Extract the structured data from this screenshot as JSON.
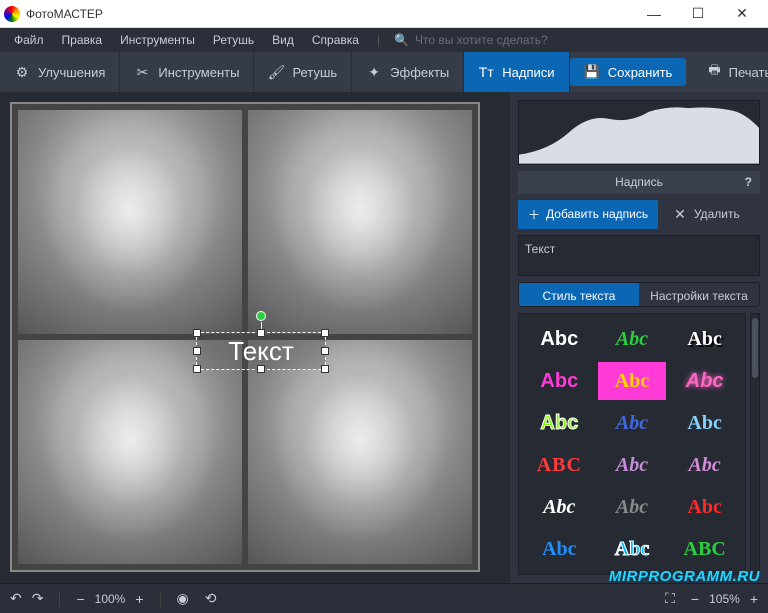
{
  "app": {
    "title": "ФотоМАСТЕР"
  },
  "menu": {
    "file": "Файл",
    "edit": "Правка",
    "tools": "Инструменты",
    "retouch": "Ретушь",
    "view": "Вид",
    "help": "Справка",
    "search_placeholder": "Что вы хотите сделать?"
  },
  "tabs": {
    "enhance": "Улучшения",
    "tools": "Инструменты",
    "retouch": "Ретушь",
    "effects": "Эффекты",
    "captions": "Надписи",
    "save": "Сохранить",
    "print": "Печать"
  },
  "canvas": {
    "overlay_text": "Текст"
  },
  "panel": {
    "title": "Надпись",
    "help": "?",
    "add": "Добавить надпись",
    "delete": "Удалить",
    "text_value": "Текст",
    "style_tab": "Стиль текста",
    "settings_tab": "Настройки текста"
  },
  "styles": [
    {
      "label": "Abc",
      "css": "color:#fff;font-family:Arial"
    },
    {
      "label": "Abc",
      "css": "color:#2ecc40;font-family:Georgia;font-style:italic"
    },
    {
      "label": "Abc",
      "css": "color:#fff;text-shadow:2px 2px 0 #000;font-family:Impact"
    },
    {
      "label": "Abc",
      "css": "color:#ff3ad6;font-family:Arial"
    },
    {
      "label": "Abc",
      "css": "color:#ffd400;background:#ff3ad6;padding:2px 6px;font-family:Impact"
    },
    {
      "label": "Abc",
      "css": "color:#ff66c4;text-shadow:0 0 6px #ff66c4;font-style:italic"
    },
    {
      "label": "Abc",
      "css": "color:#7CFC00;-webkit-text-stroke:1px #fff"
    },
    {
      "label": "Abc",
      "css": "color:#4169E1;font-style:italic;font-family:Georgia"
    },
    {
      "label": "Abc",
      "css": "color:#87CEFA;font-family:Georgia"
    },
    {
      "label": "ABC",
      "css": "color:#ff3b3b;font-family:Impact;letter-spacing:1px"
    },
    {
      "label": "Abc",
      "css": "color:#c48bd8;font-style:italic;font-family:'Brush Script MT',cursive"
    },
    {
      "label": "Abc",
      "css": "color:#d48bd8;font-style:italic;font-family:'Brush Script MT',cursive"
    },
    {
      "label": "Abc",
      "css": "color:#fff;font-style:italic;font-family:'Brush Script MT',cursive"
    },
    {
      "label": "Abc",
      "css": "color:#888;font-style:italic;font-family:'Brush Script MT',cursive"
    },
    {
      "label": "Abc",
      "css": "color:#ff2a2a;font-family:Impact"
    },
    {
      "label": "Abc",
      "css": "color:#1e90ff;font-family:Georgia"
    },
    {
      "label": "Abc",
      "css": "color:#00bfff;-webkit-text-stroke:1px #fff;font-family:Georgia"
    },
    {
      "label": "ABC",
      "css": "color:#2ecc40;font-family:Impact"
    }
  ],
  "status": {
    "zoom1": "100%",
    "zoom2": "105%"
  },
  "watermark": "MIRPROGRAMM.RU"
}
